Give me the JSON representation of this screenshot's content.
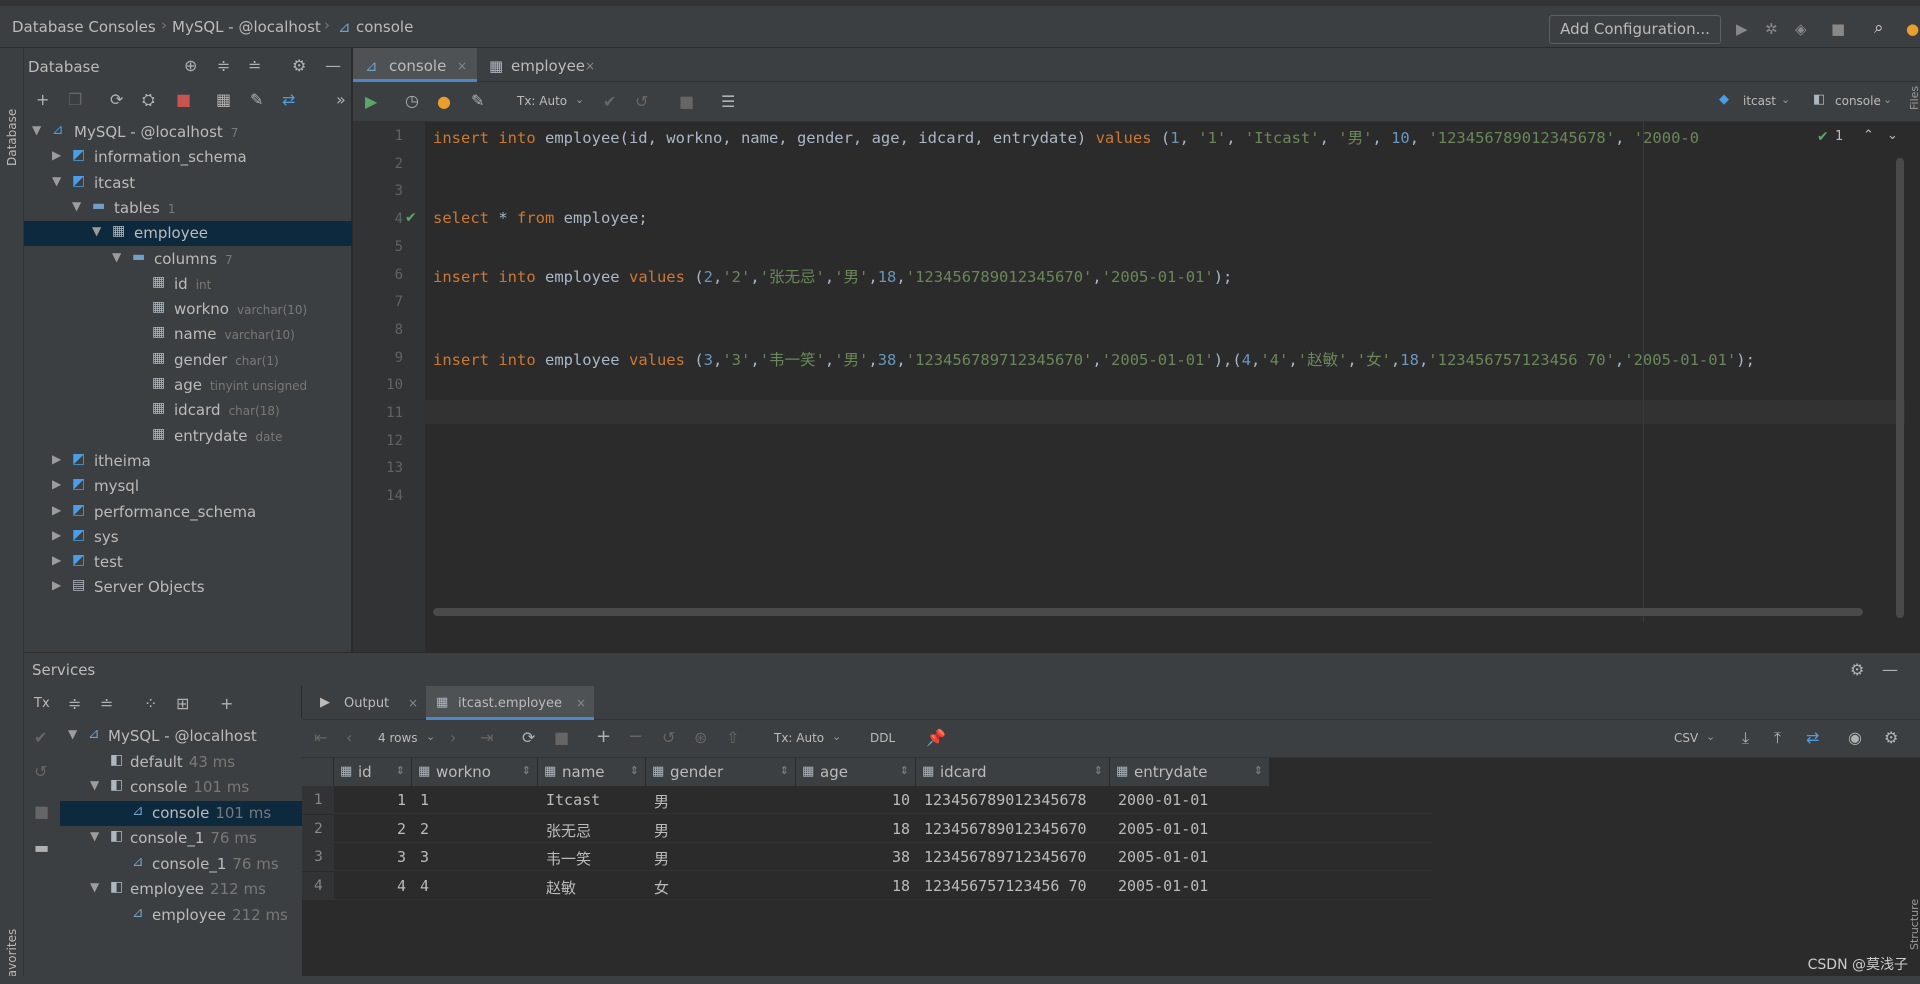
{
  "breadcrumb": [
    "Database Consoles",
    "MySQL - @localhost",
    "console"
  ],
  "toolbar": {
    "add_config": "Add Configuration..."
  },
  "left_strip": {
    "database": "Database",
    "favorites": "Favorites"
  },
  "right_strip": {
    "files": "Files",
    "structure": "Structure"
  },
  "db_panel": {
    "title": "Database",
    "tree": [
      {
        "label": "MySQL - @localhost",
        "meta": "7",
        "icon": "mysql-icon",
        "level": 0,
        "arrow": "down"
      },
      {
        "label": "information_schema",
        "meta": "",
        "icon": "schema-icon",
        "level": 1,
        "arrow": "right"
      },
      {
        "label": "itcast",
        "meta": "",
        "icon": "schema-icon",
        "level": 1,
        "arrow": "down"
      },
      {
        "label": "tables",
        "meta": "1",
        "icon": "folder-icon",
        "level": 2,
        "arrow": "down"
      },
      {
        "label": "employee",
        "meta": "",
        "icon": "table-icon",
        "level": 3,
        "arrow": "down",
        "selected": true
      },
      {
        "label": "columns",
        "meta": "7",
        "icon": "folder-icon",
        "level": 4,
        "arrow": "down"
      },
      {
        "label": "id",
        "meta": "int",
        "icon": "column-icon",
        "level": 5,
        "arrow": ""
      },
      {
        "label": "workno",
        "meta": "varchar(10)",
        "icon": "column-icon",
        "level": 5,
        "arrow": ""
      },
      {
        "label": "name",
        "meta": "varchar(10)",
        "icon": "column-icon",
        "level": 5,
        "arrow": ""
      },
      {
        "label": "gender",
        "meta": "char(1)",
        "icon": "column-icon",
        "level": 5,
        "arrow": ""
      },
      {
        "label": "age",
        "meta": "tinyint unsigned",
        "icon": "column-icon",
        "level": 5,
        "arrow": ""
      },
      {
        "label": "idcard",
        "meta": "char(18)",
        "icon": "column-icon",
        "level": 5,
        "arrow": ""
      },
      {
        "label": "entrydate",
        "meta": "date",
        "icon": "column-icon",
        "level": 5,
        "arrow": ""
      },
      {
        "label": "itheima",
        "meta": "",
        "icon": "schema-icon",
        "level": 1,
        "arrow": "right"
      },
      {
        "label": "mysql",
        "meta": "",
        "icon": "schema-icon",
        "level": 1,
        "arrow": "right"
      },
      {
        "label": "performance_schema",
        "meta": "",
        "icon": "schema-icon",
        "level": 1,
        "arrow": "right"
      },
      {
        "label": "sys",
        "meta": "",
        "icon": "schema-icon",
        "level": 1,
        "arrow": "right"
      },
      {
        "label": "test",
        "meta": "",
        "icon": "schema-icon",
        "level": 1,
        "arrow": "right"
      },
      {
        "label": "Server Objects",
        "meta": "",
        "icon": "server-objects-icon",
        "level": 1,
        "arrow": "right"
      }
    ]
  },
  "editor": {
    "tabs": [
      {
        "label": "console",
        "active": true
      },
      {
        "label": "employee",
        "active": false
      }
    ],
    "tx_mode": "Tx: Auto",
    "schema_selector": "itcast",
    "session_selector": "console",
    "inspection_count": "1",
    "lines": [
      {
        "n": "1",
        "tokens": [
          {
            "t": "insert into ",
            "c": "kw"
          },
          {
            "t": "employee(id, workno, name, gender, age, idcard, entrydate)  ",
            "c": "id"
          },
          {
            "t": "values ",
            "c": "kw"
          },
          {
            "t": "(",
            "c": "id"
          },
          {
            "t": "1",
            "c": "num"
          },
          {
            "t": ", ",
            "c": "id"
          },
          {
            "t": "'1'",
            "c": "str"
          },
          {
            "t": ", ",
            "c": "id"
          },
          {
            "t": "'Itcast'",
            "c": "str"
          },
          {
            "t": ", ",
            "c": "id"
          },
          {
            "t": "'男'",
            "c": "str"
          },
          {
            "t": ", ",
            "c": "id"
          },
          {
            "t": "10",
            "c": "num"
          },
          {
            "t": ", ",
            "c": "id"
          },
          {
            "t": "'123456789012345678'",
            "c": "str"
          },
          {
            "t": ", ",
            "c": "id"
          },
          {
            "t": "'2000-0",
            "c": "str"
          }
        ]
      },
      {
        "n": "2",
        "tokens": []
      },
      {
        "n": "3",
        "tokens": []
      },
      {
        "n": "4",
        "check": true,
        "tokens": [
          {
            "t": "select ",
            "c": "kw"
          },
          {
            "t": "* ",
            "c": "id"
          },
          {
            "t": "from ",
            "c": "kw"
          },
          {
            "t": "employee;",
            "c": "id"
          }
        ]
      },
      {
        "n": "5",
        "tokens": []
      },
      {
        "n": "6",
        "tokens": [
          {
            "t": "insert into ",
            "c": "kw"
          },
          {
            "t": "employee ",
            "c": "id"
          },
          {
            "t": "values ",
            "c": "kw"
          },
          {
            "t": "(",
            "c": "id"
          },
          {
            "t": "2",
            "c": "num"
          },
          {
            "t": ",",
            "c": "id"
          },
          {
            "t": "'2'",
            "c": "str"
          },
          {
            "t": ",",
            "c": "id"
          },
          {
            "t": "'张无忌'",
            "c": "str"
          },
          {
            "t": ",",
            "c": "id"
          },
          {
            "t": "'男'",
            "c": "str"
          },
          {
            "t": ",",
            "c": "id"
          },
          {
            "t": "18",
            "c": "num"
          },
          {
            "t": ",",
            "c": "id"
          },
          {
            "t": "'123456789012345670'",
            "c": "str"
          },
          {
            "t": ",",
            "c": "id"
          },
          {
            "t": "'2005-01-01'",
            "c": "str"
          },
          {
            "t": ");",
            "c": "id"
          }
        ]
      },
      {
        "n": "7",
        "tokens": []
      },
      {
        "n": "8",
        "tokens": []
      },
      {
        "n": "9",
        "tokens": [
          {
            "t": "insert into ",
            "c": "kw"
          },
          {
            "t": "employee ",
            "c": "id"
          },
          {
            "t": "values ",
            "c": "kw"
          },
          {
            "t": "(",
            "c": "id"
          },
          {
            "t": "3",
            "c": "num"
          },
          {
            "t": ",",
            "c": "id"
          },
          {
            "t": "'3'",
            "c": "str"
          },
          {
            "t": ",",
            "c": "id"
          },
          {
            "t": "'韦一笑'",
            "c": "str"
          },
          {
            "t": ",",
            "c": "id"
          },
          {
            "t": "'男'",
            "c": "str"
          },
          {
            "t": ",",
            "c": "id"
          },
          {
            "t": "38",
            "c": "num"
          },
          {
            "t": ",",
            "c": "id"
          },
          {
            "t": "'123456789712345670'",
            "c": "str"
          },
          {
            "t": ",",
            "c": "id"
          },
          {
            "t": "'2005-01-01'",
            "c": "str"
          },
          {
            "t": "),(",
            "c": "id"
          },
          {
            "t": "4",
            "c": "num"
          },
          {
            "t": ",",
            "c": "id"
          },
          {
            "t": "'4'",
            "c": "str"
          },
          {
            "t": ",",
            "c": "id"
          },
          {
            "t": "'赵敏'",
            "c": "str"
          },
          {
            "t": ",",
            "c": "id"
          },
          {
            "t": "'女'",
            "c": "str"
          },
          {
            "t": ",",
            "c": "id"
          },
          {
            "t": "18",
            "c": "num"
          },
          {
            "t": ",",
            "c": "id"
          },
          {
            "t": "'123456757123456 70'",
            "c": "str"
          },
          {
            "t": ",",
            "c": "id"
          },
          {
            "t": "'2005-01-01'",
            "c": "str"
          },
          {
            "t": ");",
            "c": "id"
          }
        ]
      },
      {
        "n": "10",
        "tokens": []
      },
      {
        "n": "11",
        "tokens": []
      },
      {
        "n": "12",
        "tokens": []
      },
      {
        "n": "13",
        "tokens": []
      },
      {
        "n": "14",
        "tokens": []
      }
    ]
  },
  "services": {
    "title": "Services",
    "tree": [
      {
        "label": "MySQL - @localhost",
        "meta": "",
        "level": 0,
        "arrow": "down"
      },
      {
        "label": "default",
        "meta": "43 ms",
        "level": 1,
        "arrow": ""
      },
      {
        "label": "console",
        "meta": "101 ms",
        "level": 1,
        "arrow": "down"
      },
      {
        "label": "console",
        "meta": "101 ms",
        "level": 2,
        "arrow": "",
        "selected": true
      },
      {
        "label": "console_1",
        "meta": "76 ms",
        "level": 1,
        "arrow": "down"
      },
      {
        "label": "console_1",
        "meta": "76 ms",
        "level": 2,
        "arrow": ""
      },
      {
        "label": "employee",
        "meta": "212 ms",
        "level": 1,
        "arrow": "down"
      },
      {
        "label": "employee",
        "meta": "212 ms",
        "level": 2,
        "arrow": ""
      }
    ],
    "tx_label": "Tx"
  },
  "results": {
    "tabs": [
      {
        "label": "Output",
        "active": false
      },
      {
        "label": "itcast.employee",
        "active": true
      }
    ],
    "rows_label": "4 rows",
    "tx_mode": "Tx: Auto",
    "ddl": "DDL",
    "export_format": "CSV",
    "columns": [
      "id",
      "workno",
      "name",
      "gender",
      "age",
      "idcard",
      "entrydate"
    ],
    "rows": [
      [
        "1",
        "1",
        "1",
        "Itcast",
        "男",
        "10",
        "123456789012345678",
        "2000-01-01"
      ],
      [
        "2",
        "2",
        "2",
        "张无忌",
        "男",
        "18",
        "123456789012345670",
        "2005-01-01"
      ],
      [
        "3",
        "3",
        "3",
        "韦一笑",
        "男",
        "38",
        "123456789712345670",
        "2005-01-01"
      ],
      [
        "4",
        "4",
        "4",
        "赵敏",
        "女",
        "18",
        "123456757123456 70",
        "2005-01-01"
      ]
    ]
  },
  "watermark": "CSDN @莫浅子",
  "colors": {
    "keyword": "#cc7832",
    "string": "#6a8759",
    "number": "#6897bb",
    "selection": "#0d293e",
    "accent": "#4a88c7"
  }
}
